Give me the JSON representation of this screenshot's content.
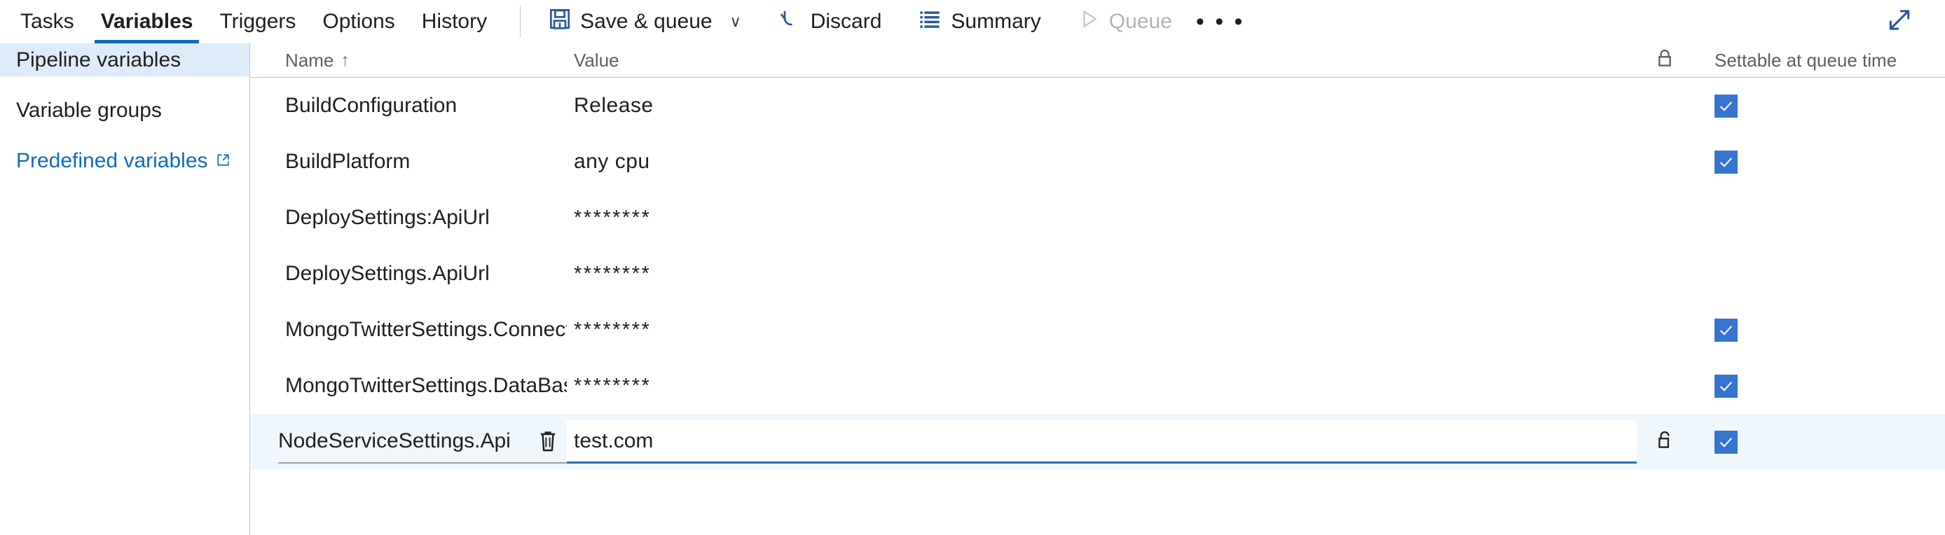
{
  "toolbar": {
    "tabs": [
      {
        "label": "Tasks",
        "active": false
      },
      {
        "label": "Variables",
        "active": true
      },
      {
        "label": "Triggers",
        "active": false
      },
      {
        "label": "Options",
        "active": false
      },
      {
        "label": "History",
        "active": false
      }
    ],
    "save_queue_label": "Save & queue",
    "save_queue_caret": "∨",
    "discard_label": "Discard",
    "summary_label": "Summary",
    "queue_label": "Queue",
    "queue_disabled": true,
    "overflow_label": "• • •",
    "accent_blue": "#2b5797",
    "link_blue": "#0f6cbd"
  },
  "sidebar": {
    "items": [
      {
        "label": "Pipeline variables",
        "selected": true,
        "external": false
      },
      {
        "label": "Variable groups",
        "selected": false,
        "external": false
      },
      {
        "label": "Predefined variables",
        "selected": false,
        "external": true
      }
    ]
  },
  "table": {
    "headers": {
      "name": "Name",
      "name_sort": "↑",
      "value": "Value",
      "lock": "lock-icon",
      "settable": "Settable at queue time"
    },
    "rows": [
      {
        "name": "BuildConfiguration",
        "value": "Release",
        "secret": false,
        "settable": true,
        "active": false
      },
      {
        "name": "BuildPlatform",
        "value": "any cpu",
        "secret": false,
        "settable": true,
        "active": false
      },
      {
        "name": "DeploySettings:ApiUrl",
        "value": "********",
        "secret": true,
        "settable": false,
        "active": false
      },
      {
        "name": "DeploySettings.ApiUrl",
        "value": "********",
        "secret": true,
        "settable": false,
        "active": false
      },
      {
        "name": "MongoTwitterSettings.ConnectionString",
        "value": "********",
        "secret": true,
        "settable": true,
        "active": false
      },
      {
        "name": "MongoTwitterSettings.DataBase",
        "value": "********",
        "secret": true,
        "settable": true,
        "active": false
      },
      {
        "name": "NodeServiceSettings.Api",
        "value": "test.com",
        "secret": false,
        "settable": true,
        "active": true
      }
    ],
    "partial_row": {
      "name": "",
      "value": "",
      "settable": false
    }
  },
  "colors": {
    "selected_row": "#eff6fc",
    "sidebar_selected": "#deecf9",
    "checkbox_blue": "#3575cf",
    "focus_underline": "#2b70b8",
    "divider": "#c8c6c4"
  }
}
